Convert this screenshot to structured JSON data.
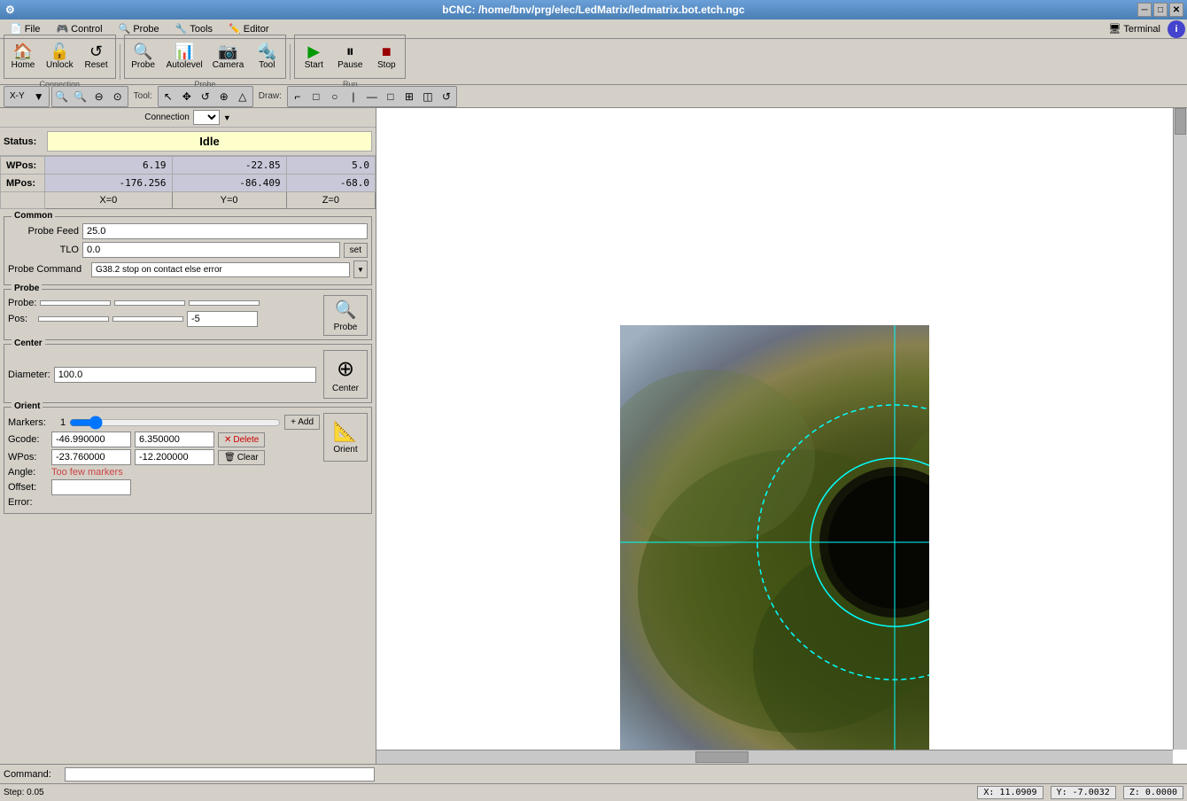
{
  "window": {
    "title": "bCNC: /home/bnv/prg/elec/LedMatrix/ledmatrix.bot.etch.ngc",
    "icon": "⚙"
  },
  "menubar": {
    "items": [
      {
        "label": "File",
        "icon": "📄"
      },
      {
        "label": "Control",
        "icon": "🎮"
      },
      {
        "label": "Probe",
        "icon": "🔍"
      },
      {
        "label": "Tools",
        "icon": "🔧"
      },
      {
        "label": "Editor",
        "icon": "✏️"
      }
    ],
    "terminal": "Terminal",
    "info_icon": "i"
  },
  "toolbar": {
    "home_label": "Home",
    "unlock_label": "Unlock",
    "reset_label": "Reset",
    "probe_label": "Probe",
    "autolevel_label": "Autolevel",
    "camera_label": "Camera",
    "tool_label": "Tool",
    "start_label": "Start",
    "pause_label": "Pause",
    "stop_label": "Stop",
    "connection_group": "Connection",
    "probe_group": "Probe",
    "run_group": "Run"
  },
  "subtoolbar": {
    "view_label": "X-Y",
    "tool_label": "Tool:",
    "draw_label": "Draw:"
  },
  "status": {
    "label": "Status:",
    "value": "Idle"
  },
  "wpos": {
    "label": "WPos:",
    "x": "6.19",
    "y": "-22.85",
    "z": "5.0"
  },
  "mpos": {
    "label": "MPos:",
    "x": "-176.256",
    "y": "-86.409",
    "z": "-68.0"
  },
  "zero_buttons": {
    "x": "X=0",
    "y": "Y=0",
    "z": "Z=0"
  },
  "common": {
    "title": "Common",
    "probe_feed_label": "Probe Feed",
    "probe_feed_value": "25.0",
    "tlo_label": "TLO",
    "tlo_value": "0.0",
    "tlo_set": "set",
    "probe_cmd_label": "Probe Command",
    "probe_cmd_value": "G38.2 stop on contact else error",
    "probe_cmd_arrow": "▼"
  },
  "probe_section": {
    "title": "Probe",
    "probe_label": "Probe:",
    "pos_label": "Pos:",
    "pos_z": "-5",
    "probe_btn": "Probe",
    "probe_icon": "🔍"
  },
  "center_section": {
    "title": "Center",
    "diameter_label": "Diameter:",
    "diameter_value": "100.0",
    "center_btn": "Center",
    "center_icon": "⊕"
  },
  "orient_section": {
    "title": "Orient",
    "markers_label": "Markers:",
    "markers_value": "1",
    "add_btn": "+ Add",
    "gcode_label": "Gcode:",
    "gcode_x": "-46.990000",
    "gcode_y": "6.350000",
    "delete_btn": "Delete",
    "delete_icon": "✕",
    "wpos_label": "WPos:",
    "wpos_x": "-23.760000",
    "wpos_y": "-12.200000",
    "clear_btn": "Clear",
    "clear_icon": "🗑",
    "angle_label": "Angle:",
    "angle_value": "Too few markers",
    "offset_label": "Offset:",
    "offset_value": "",
    "error_label": "Error:",
    "error_value": "",
    "orient_btn": "Orient",
    "orient_icon": "📐"
  },
  "bottom": {
    "command_label": "Command:",
    "command_placeholder": "",
    "step_label": "Step: 0.05"
  },
  "statusbar": {
    "x_coord": "X: 11.0909",
    "y_coord": "Y: -7.0032",
    "z_coord": "Z: 0.0000"
  },
  "camera": {
    "crosshair_color": "#00ffff",
    "inner_circle_r": 95,
    "outer_circle_r": 155
  }
}
